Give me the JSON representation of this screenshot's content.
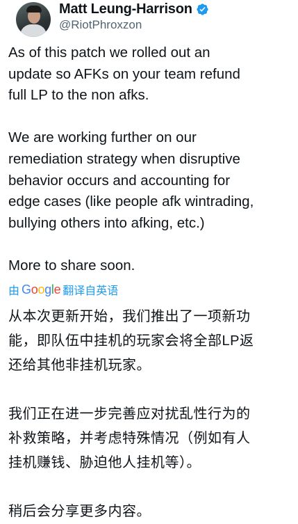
{
  "author": {
    "display_name": "Matt Leung-Harrison",
    "handle": "@RiotPhroxzon",
    "verified_icon": "verified-badge-icon"
  },
  "tweet": {
    "english_text": "As of this patch we rolled out an\nupdate so AFKs on your team refund\nfull LP to the non afks.\n\nWe are working further on our\nremediation strategy when disruptive\nbehavior occurs and accounting for\nedge cases (like people afk wintrading,\nbullying others into afking, etc.)\n\nMore to share soon.",
    "translation": {
      "prefix": "由",
      "provider": "Google",
      "suffix": "翻译自英语"
    },
    "chinese_text": "从本次更新开始，我们推出了一项新功\n能，即队伍中挂机的玩家会将全部LP返\n还给其他非挂机玩家。\n\n我们正在进一步完善应对扰乱性行为的\n补救策略，并考虑特殊情况（例如有人\n挂机赚钱、胁迫他人挂机等）。\n\n稍后会分享更多内容。"
  },
  "colors": {
    "verified": "#1d9bf0",
    "link": "#1d9bf0",
    "secondary_text": "#536471",
    "google_blue": "#4285f4",
    "google_red": "#ea4335",
    "google_yellow": "#fbbc05",
    "google_green": "#34a853"
  }
}
